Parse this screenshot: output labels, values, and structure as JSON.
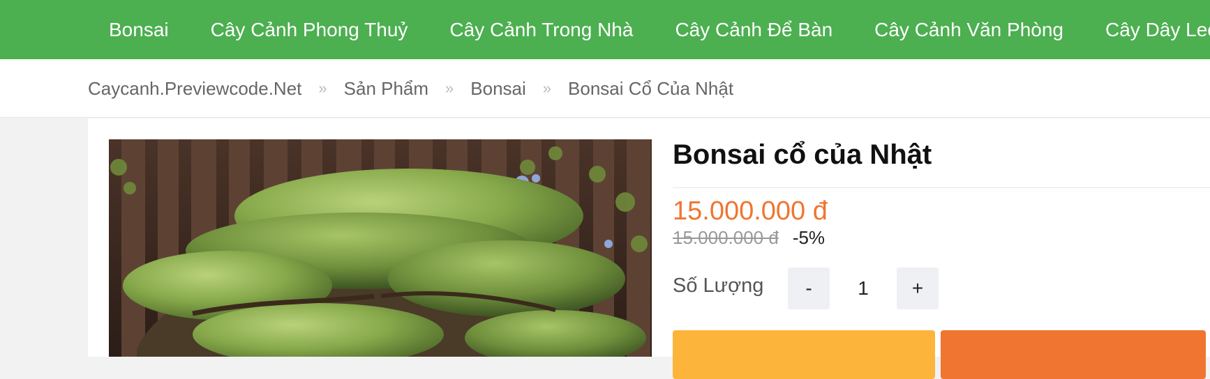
{
  "nav": {
    "items": [
      "Bonsai",
      "Cây Cảnh Phong Thuỷ",
      "Cây Cảnh Trong Nhà",
      "Cây Cảnh Để Bàn",
      "Cây Cảnh Văn Phòng",
      "Cây Dây Leo"
    ]
  },
  "breadcrumb": {
    "items": [
      "Caycanh.Previewcode.Net",
      "Sản Phẩm",
      "Bonsai",
      "Bonsai Cổ Của Nhật"
    ],
    "separator": "»"
  },
  "product": {
    "title": "Bonsai cổ của Nhật",
    "price": "15.000.000 đ",
    "old_price": "15.000.000 đ",
    "discount": "-5%",
    "quantity_label": "Số Lượng",
    "quantity": "1",
    "minus": "-",
    "plus": "+"
  },
  "colors": {
    "nav_bg": "#4caf50",
    "price": "#f07530",
    "buy_button": "#fcb53a",
    "cart_button": "#f07530"
  }
}
